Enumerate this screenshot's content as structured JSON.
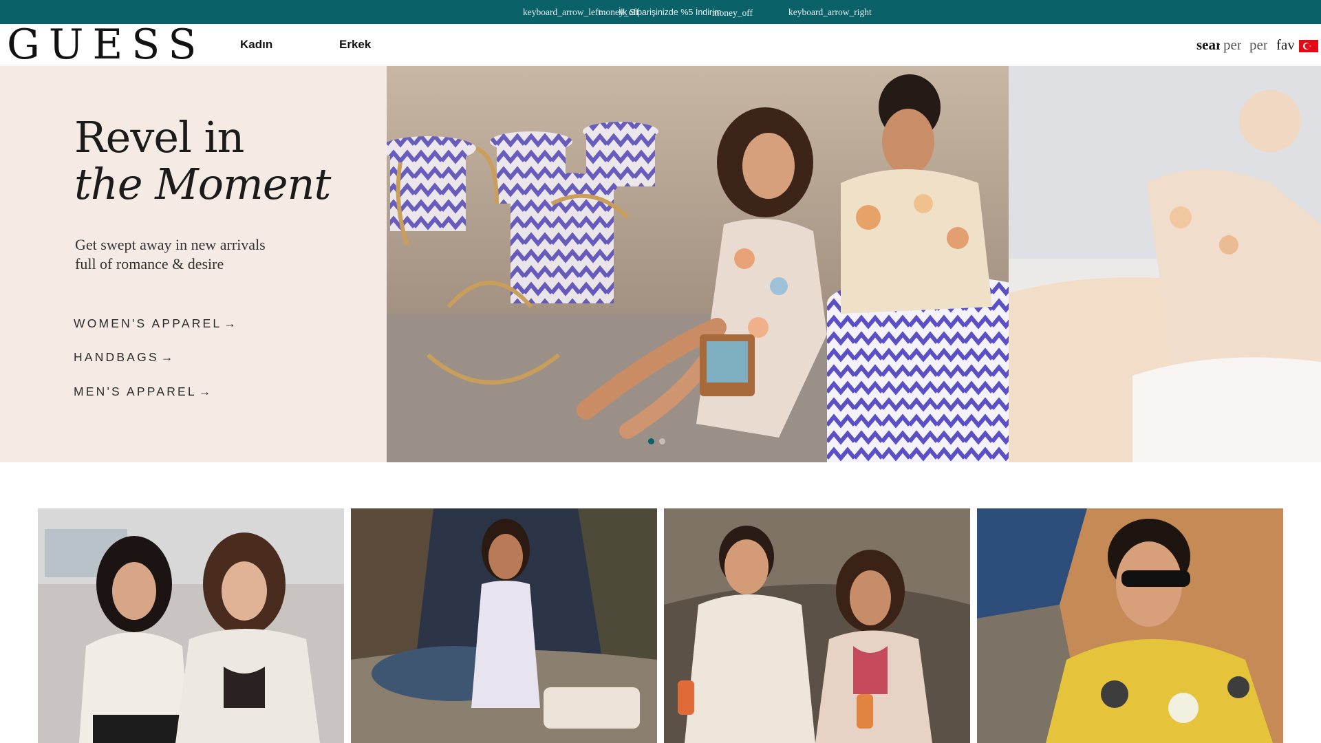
{
  "promo": {
    "arrow_left_icon": "keyboard_arrow_left",
    "icon_a": "money_off",
    "message": "İlk Siparişinizde %5 İndirim",
    "icon_b": "money_off",
    "arrow_right_icon": "keyboard_arrow_right",
    "background": "#0a6168"
  },
  "header": {
    "logo": "GUESS",
    "nav": [
      "Kadın",
      "Erkek"
    ],
    "utilities": {
      "search": "search",
      "person_1": "person",
      "person_2": "person",
      "favorite": "favorite"
    },
    "flag": "turkey-flag-icon"
  },
  "hero": {
    "title_line1": "Revel in",
    "title_line2": "the Moment",
    "subtitle_line1": "Get swept away in new arrivals",
    "subtitle_line2": "full of romance & desire",
    "links": [
      {
        "label": "WOMEN'S APPAREL",
        "arrow": "→"
      },
      {
        "label": "HANDBAGS",
        "arrow": "→"
      },
      {
        "label": "MEN'S APPAREL",
        "arrow": "→"
      }
    ],
    "panel_color": "#f5ebe4",
    "carousel_dots": 2,
    "active_dot": 0
  },
  "tiles": [
    {
      "name": "tile-women-duo",
      "icon": "photo"
    },
    {
      "name": "tile-white-dress",
      "icon": "photo"
    },
    {
      "name": "tile-couple",
      "icon": "photo"
    },
    {
      "name": "tile-men-sunglasses",
      "icon": "photo"
    }
  ]
}
